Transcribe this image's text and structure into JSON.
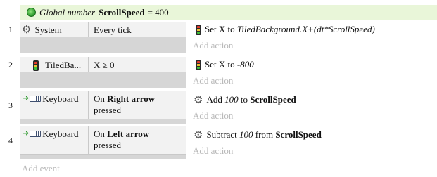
{
  "global": {
    "keyword": "Global number",
    "name": "ScrollSpeed",
    "suffix": "= 400"
  },
  "events": [
    {
      "number": "1",
      "object": "System",
      "condition": "Every tick",
      "action": {
        "prefix": "Set X to ",
        "expr": "TiledBackground.X+(dt*ScrollSpeed)"
      },
      "add_action": "Add action"
    },
    {
      "number": "2",
      "object": "TiledBa...",
      "condition": "X ≥ 0",
      "action": {
        "prefix": "Set X to ",
        "expr": "-800"
      },
      "add_action": "Add action"
    },
    {
      "number": "3",
      "object": "Keyboard",
      "condition": {
        "pre": "On ",
        "key": "Right arrow",
        "post": "pressed"
      },
      "action": {
        "pre": "Add ",
        "value": "100",
        "mid": " to ",
        "var": "ScrollSpeed"
      },
      "add_action": "Add action"
    },
    {
      "number": "4",
      "object": "Keyboard",
      "condition": {
        "pre": "On ",
        "key": "Left arrow",
        "post": "pressed"
      },
      "action": {
        "pre": "Subtract ",
        "value": "100",
        "mid": " from ",
        "var": "ScrollSpeed"
      },
      "add_action": "Add action"
    }
  ],
  "add_event": "Add event",
  "icons": {
    "global": "globe-icon",
    "system": "gear-icon",
    "sprite": "traffic-light-icon",
    "keyboard": "keyboard-icon",
    "trigger": "trigger-arrow-icon"
  },
  "colors": {
    "global_bg": "#e9f6d9",
    "condition_bg": "#f2f2f2",
    "condition_area_bg": "#d6d6d6",
    "placeholder_text": "#b8b8b8"
  }
}
